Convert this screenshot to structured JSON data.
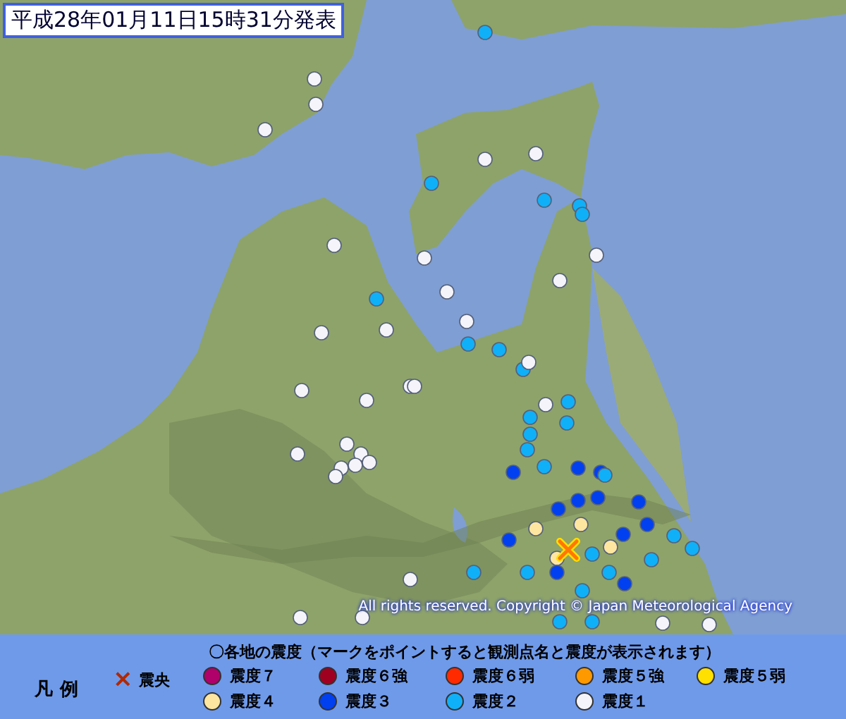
{
  "title": "平成28年01月11日15時31分発表",
  "copyright": "All rights reserved. Copyright © Japan Meteorological Agency",
  "legend": {
    "heading": "〇各地の震度（マークをポイントすると観測点名と震度が表示されます）",
    "label": "凡 例",
    "epicenter": {
      "symbol": "×",
      "label": "震央"
    },
    "items": [
      {
        "label": "震度７",
        "color": "#b0006a"
      },
      {
        "label": "震度６強",
        "color": "#a00020"
      },
      {
        "label": "震度６弱",
        "color": "#ff2a00"
      },
      {
        "label": "震度５強",
        "color": "#ff9900"
      },
      {
        "label": "震度５弱",
        "color": "#ffe000"
      },
      {
        "label": "震度４",
        "color": "#ffe6a0"
      },
      {
        "label": "震度３",
        "color": "#0040f0"
      },
      {
        "label": "震度２",
        "color": "#10b0f8"
      },
      {
        "label": "震度１",
        "color": "#f4f4fa"
      }
    ]
  }
}
